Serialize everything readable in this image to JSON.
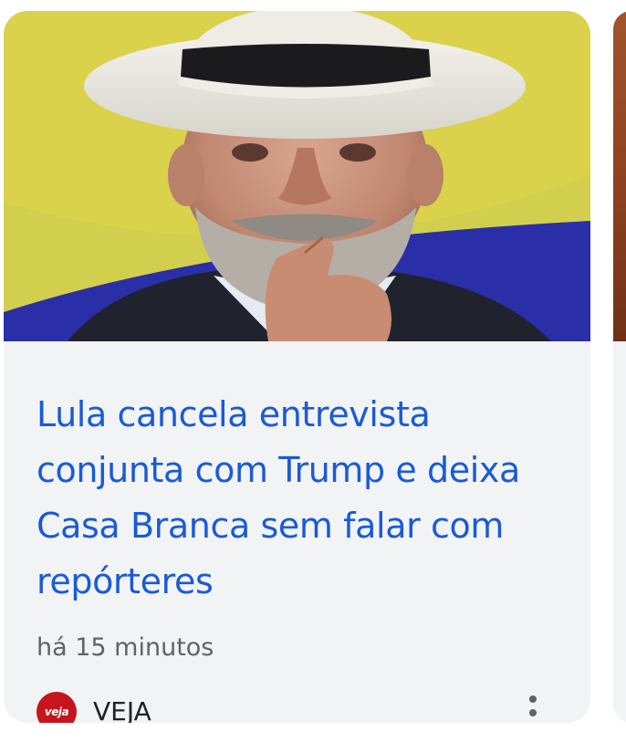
{
  "card": {
    "image_alt": "Lula com chapéu branco, mão no queixo",
    "headline": "Lula cancela entrevista conjunta com Trump e deixa Casa Branca sem falar com repórteres",
    "timestamp": "há 15 minutos",
    "source": {
      "name": "VEJA",
      "logo_text": "veja",
      "logo_color": "#c4161c"
    },
    "more_icon": "more-vert-icon"
  },
  "colors": {
    "headline": "#1a5bd4",
    "card_background": "#f1f3f4",
    "meta_text": "#5f6368"
  }
}
